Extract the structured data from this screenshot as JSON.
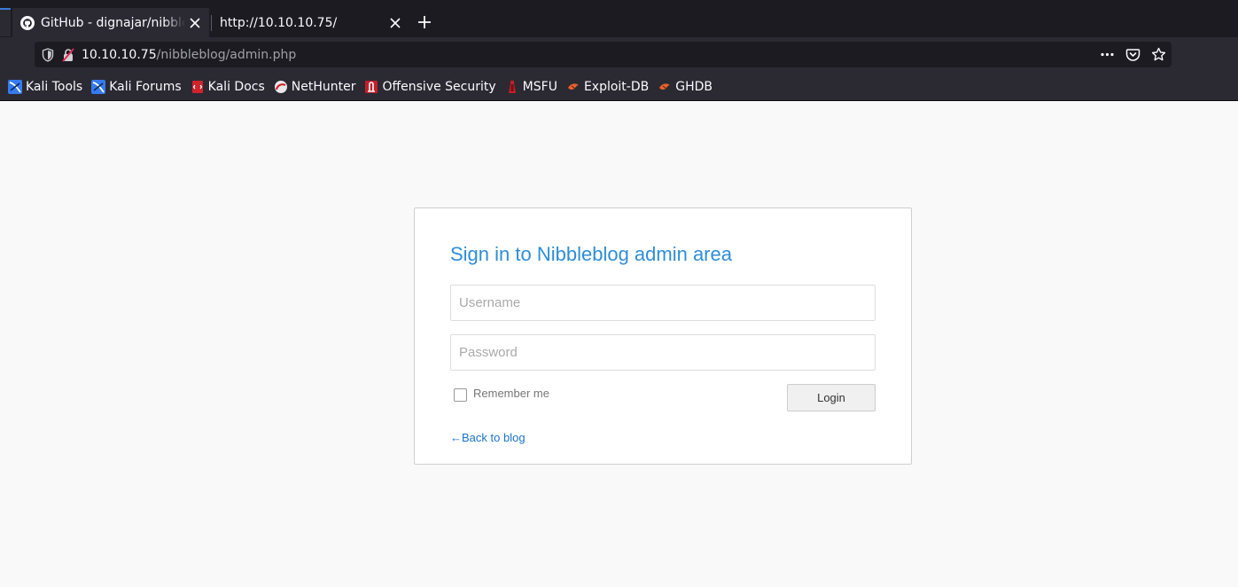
{
  "browser": {
    "tabs": [
      {
        "title": "GitHub - dignajar/nibbleblog",
        "icon": "github-icon",
        "active": false
      },
      {
        "title": "http://10.10.10.75/",
        "icon": "none",
        "active": true
      }
    ],
    "url": {
      "host": "10.10.10.75",
      "path": "/nibbleblog/admin.php"
    },
    "bookmarks": [
      {
        "label": "Kali Tools",
        "icon": "kali-icon"
      },
      {
        "label": "Kali Forums",
        "icon": "kali-icon"
      },
      {
        "label": "Kali Docs",
        "icon": "kali-docs-icon"
      },
      {
        "label": "NetHunter",
        "icon": "nethunter-icon"
      },
      {
        "label": "Offensive Security",
        "icon": "offsec-icon"
      },
      {
        "label": "MSFU",
        "icon": "msfu-icon"
      },
      {
        "label": "Exploit-DB",
        "icon": "exploitdb-icon"
      },
      {
        "label": "GHDB",
        "icon": "ghdb-icon"
      }
    ]
  },
  "login": {
    "heading": "Sign in to Nibbleblog admin area",
    "username_placeholder": "Username",
    "password_placeholder": "Password",
    "remember_label": "Remember me",
    "login_button": "Login",
    "back_link": "←Back to blog"
  },
  "colors": {
    "heading": "#2e8ed8",
    "link": "#1a73c8",
    "chrome_dark": "#1c1b22",
    "chrome": "#2b2a33"
  }
}
